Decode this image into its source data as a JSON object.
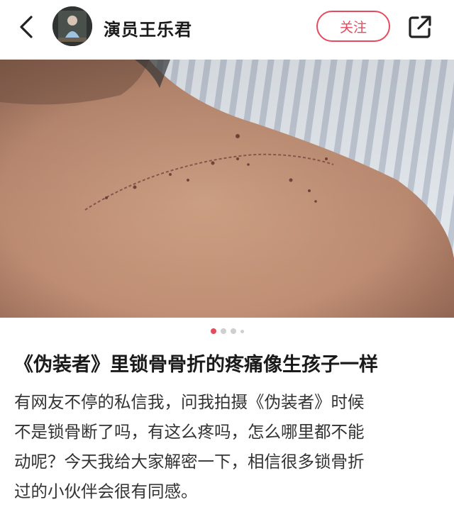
{
  "header": {
    "username": "演员王乐君",
    "follow_label": "关注"
  },
  "icons": {
    "back": "chevron-left-icon",
    "share": "share-external-icon"
  },
  "carousel": {
    "total_dots": 4,
    "active_index": 0
  },
  "article": {
    "title": "《伪装者》里锁骨骨折的疼痛像生孩子一样",
    "lines": [
      "有网友不停的私信我，问我拍摄《伪装者》时候",
      "不是锁骨断了吗，有这么疼吗，怎么哪里都不能",
      "动呢？今天我给大家解密一下，相信很多锁骨折",
      "过的小伙伴会很有同感。"
    ]
  },
  "colors": {
    "accent": "#e64a5e",
    "text": "#333333"
  }
}
